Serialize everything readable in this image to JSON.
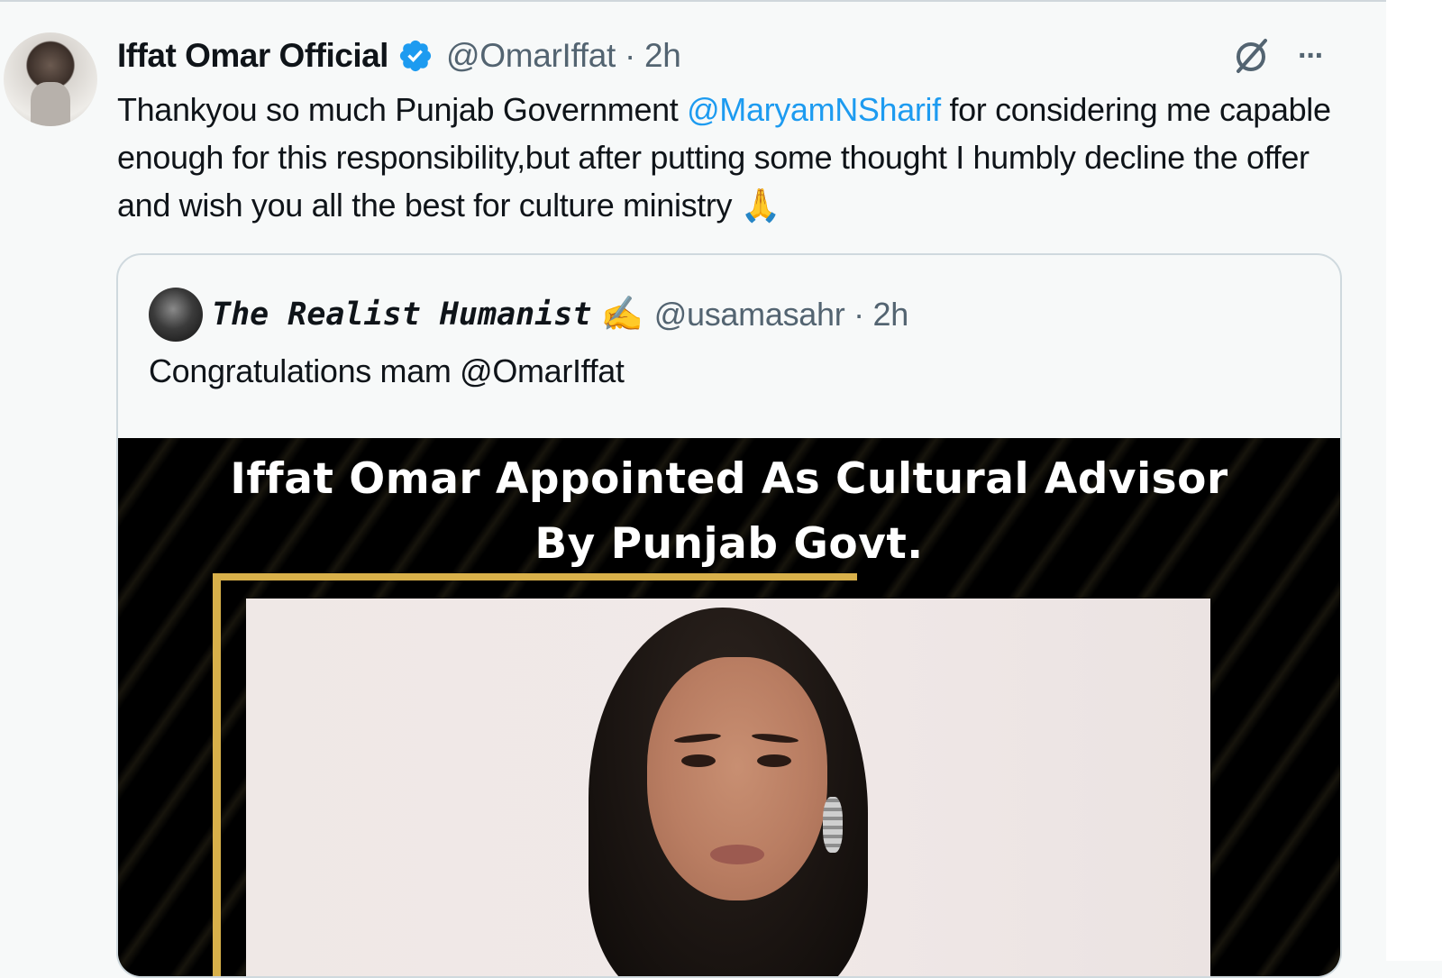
{
  "tweet": {
    "author_name": "Iffat Omar Official",
    "handle_time": "@OmarIffat · 2h",
    "text_before": "Thankyou so much Punjab Government ",
    "mention": "@MaryamNSharif",
    "text_after": " for considering me capable enough for this responsibility,but after putting some thought I humbly decline the offer and wish you all the best for culture ministry ",
    "emoji": "🙏",
    "more_label": "···"
  },
  "quote": {
    "author_name": "The Realist Humanist",
    "author_emoji": "✍️",
    "handle_time": "@usamasahr · 2h",
    "text": "Congratulations mam @OmarIffat",
    "media_headline_line1": "Iffat Omar Appointed As Cultural Advisor",
    "media_headline_line2": "By Punjab Govt."
  },
  "colors": {
    "accent_blue": "#1d9bf0",
    "verified_blue": "#1d9bf0",
    "gold_frame": "#d8b04a",
    "background": "#f7f9f9"
  },
  "icons": [
    "verified-badge-icon",
    "grok-icon",
    "more-options-icon"
  ]
}
